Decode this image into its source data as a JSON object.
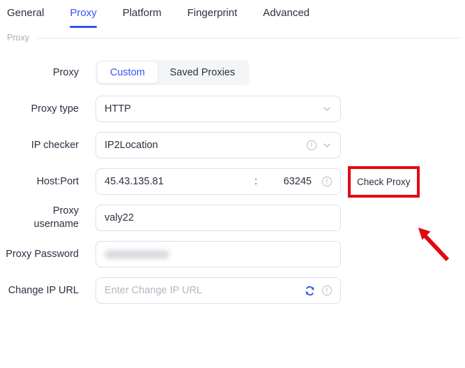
{
  "tabs": [
    {
      "label": "General",
      "active": false
    },
    {
      "label": "Proxy",
      "active": true
    },
    {
      "label": "Platform",
      "active": false
    },
    {
      "label": "Fingerprint",
      "active": false
    },
    {
      "label": "Advanced",
      "active": false
    }
  ],
  "section": {
    "title": "Proxy"
  },
  "form": {
    "proxy_mode": {
      "label": "Proxy",
      "options": [
        {
          "label": "Custom",
          "selected": true
        },
        {
          "label": "Saved Proxies",
          "selected": false
        }
      ]
    },
    "proxy_type": {
      "label": "Proxy type",
      "value": "HTTP"
    },
    "ip_checker": {
      "label": "IP checker",
      "value": "IP2Location"
    },
    "host_port": {
      "label": "Host:Port",
      "host": "45.43.135.81",
      "separator": ":",
      "port": "63245",
      "check_button": "Check Proxy"
    },
    "proxy_username": {
      "label": "Proxy\nusername",
      "value": "valy22"
    },
    "proxy_password": {
      "label": "Proxy Password",
      "value": ""
    },
    "change_ip_url": {
      "label": "Change IP URL",
      "value": "",
      "placeholder": "Enter Change IP URL"
    }
  },
  "colors": {
    "accent": "#3355ff",
    "tab_underline": "#2f54eb",
    "annotation": "#e30613",
    "label_text": "#2b3040",
    "muted_text": "#a8acb6",
    "border": "#dcdfe6",
    "segment_track": "#f4f5f7"
  }
}
